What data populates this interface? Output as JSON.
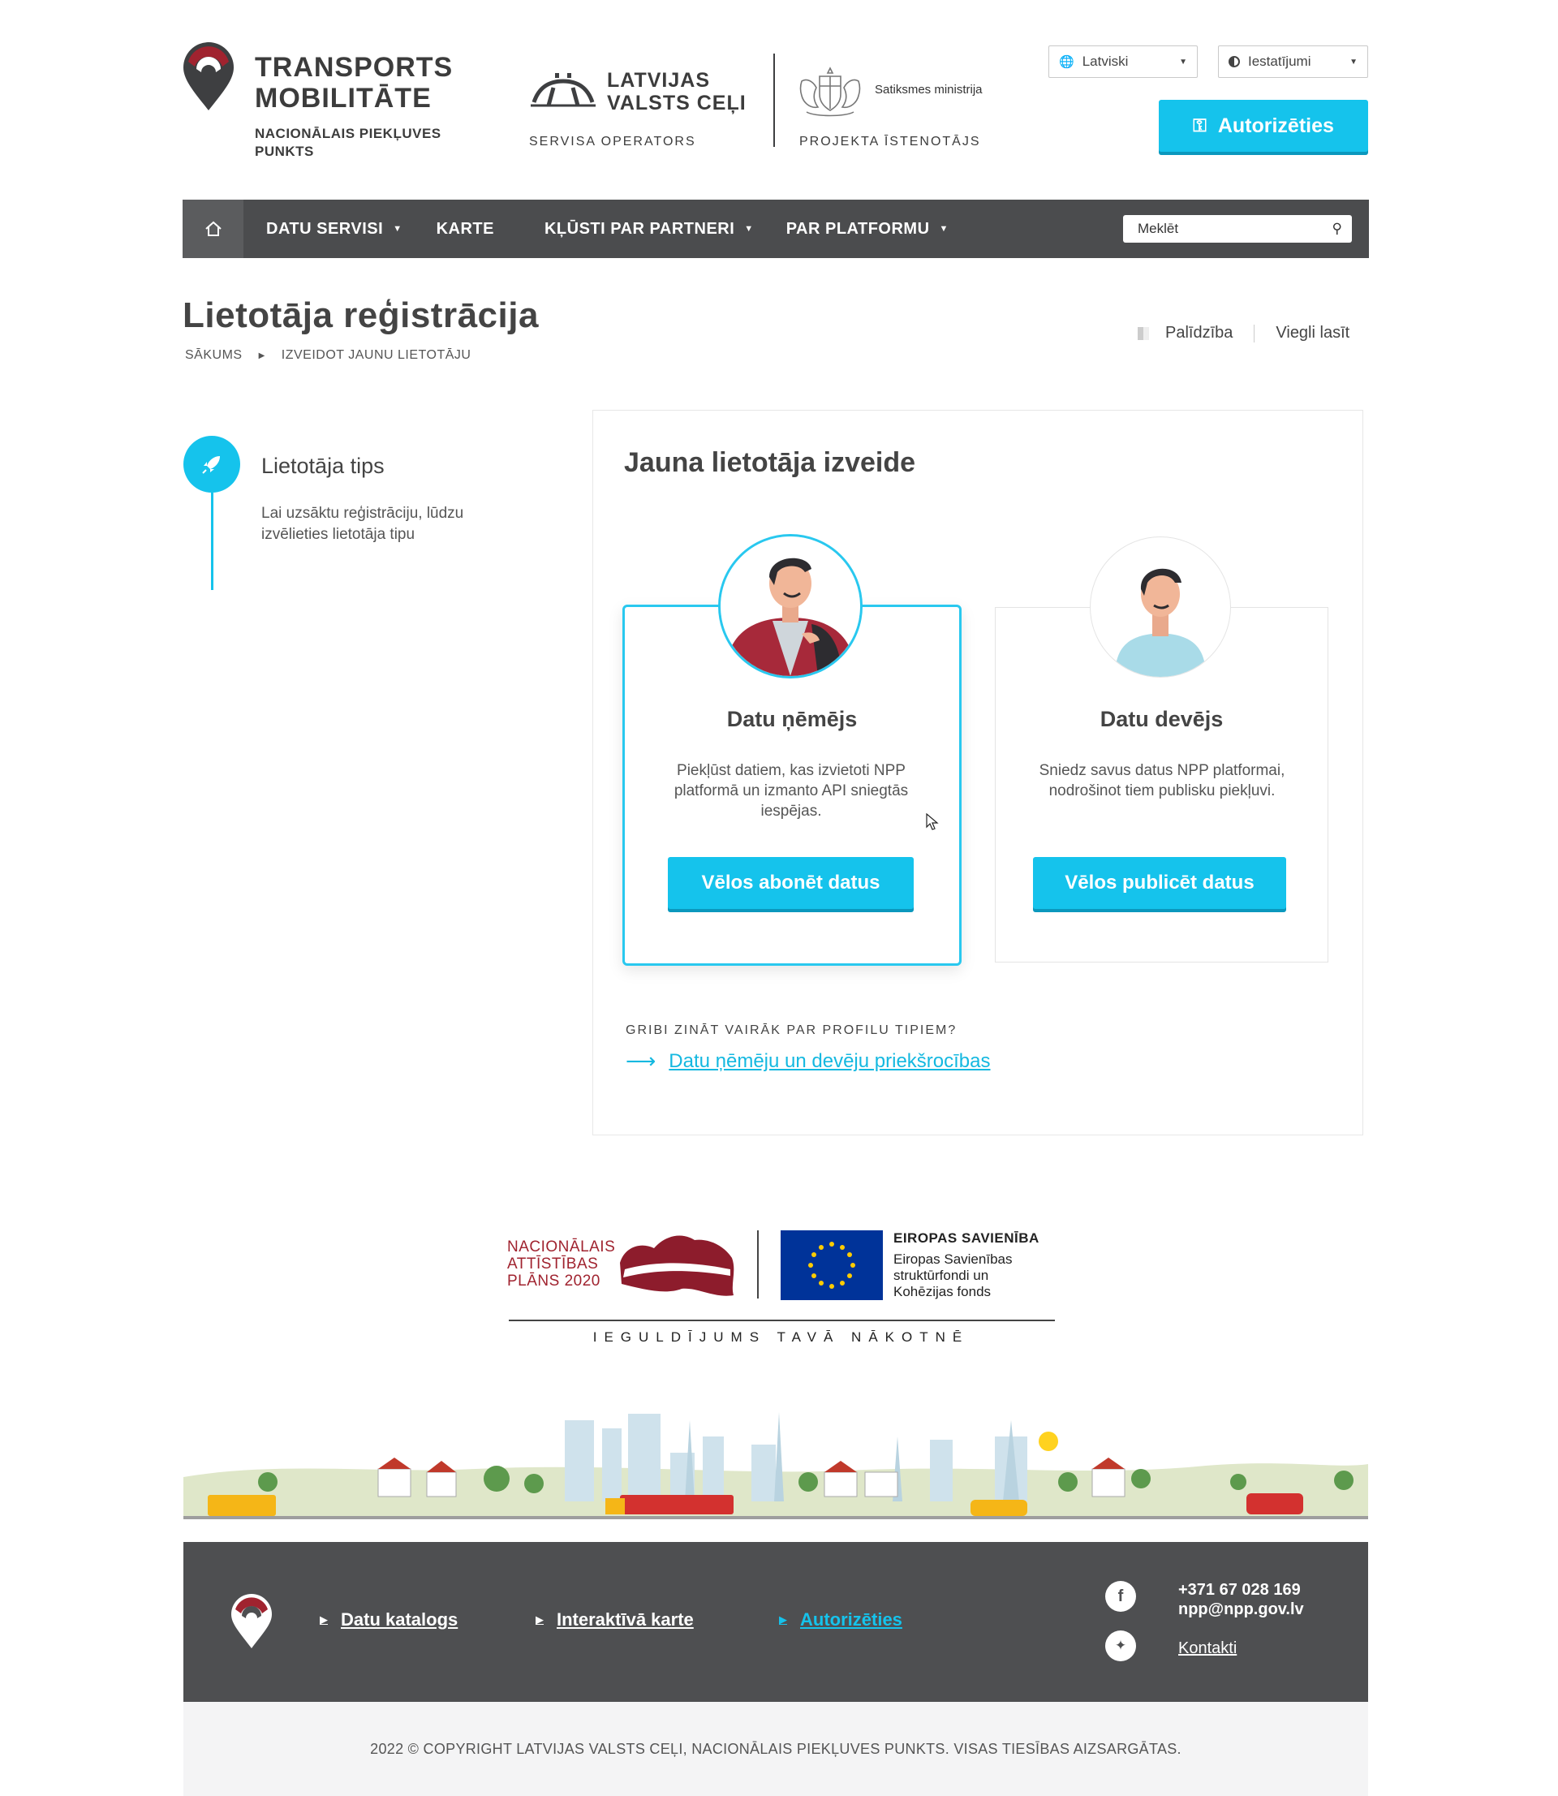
{
  "header": {
    "brand_title_1": "TRANSPORTS",
    "brand_title_2": "MOBILITĀTE",
    "brand_sub_1": "NACIONĀLAIS PIEKĻUVES",
    "brand_sub_2": "PUNKTS",
    "lvc_title_1": "LATVIJAS",
    "lvc_title_2": "VALSTS CEĻI",
    "lvc_role": "SERVISA OPERATORS",
    "ministry_name": "Satiksmes ministrija",
    "ministry_role": "PROJEKTA ĪSTENOTĀJS",
    "language": "Latviski",
    "settings": "Iestatījumi",
    "login_button": "Autorizēties"
  },
  "nav": {
    "items": [
      {
        "label": "DATU SERVISI",
        "dropdown": true
      },
      {
        "label": "KARTE",
        "dropdown": false
      },
      {
        "label": "KĻŪSTI PAR PARTNERI",
        "dropdown": true
      },
      {
        "label": "PAR PLATFORMU",
        "dropdown": true
      }
    ],
    "search_placeholder": "Meklēt"
  },
  "page": {
    "title": "Lietotāja reģistrācija",
    "breadcrumb": [
      "SĀKUMS",
      "IZVEIDOT JAUNU LIETOTĀJU"
    ],
    "help": "Palīdzība",
    "easy_read": "Viegli lasīt"
  },
  "steps": {
    "title": "Lietotāja tips",
    "description": "Lai uzsāktu reģistrāciju, lūdzu izvēlieties lietotāja tipu"
  },
  "panel": {
    "title": "Jauna lietotāja izveide",
    "cards": [
      {
        "title": "Datu ņēmējs",
        "text": "Piekļūst datiem, kas izvietoti NPP platformā un izmanto API sniegtās iespējas.",
        "button": "Vēlos abonēt datus"
      },
      {
        "title": "Datu devējs",
        "text": "Sniedz savus datus NPP platformai, nodrošinot tiem publisku piekļuvi.",
        "button": "Vēlos publicēt datus"
      }
    ],
    "more_label": "GRIBI ZINĀT VAIRĀK PAR PROFILU TIPIEM?",
    "more_link": "Datu ņēmēju un devēju priekšrocības"
  },
  "eu": {
    "nap_1": "NACIONĀLAIS",
    "nap_2": "ATTĪSTĪBAS",
    "nap_3": "PLĀNS 2020",
    "eu_title": "EIROPAS SAVIENĪBA",
    "eu_line_1": "Eiropas Savienības",
    "eu_line_2": "struktūrfondi un",
    "eu_line_3": "Kohēzijas fonds",
    "slogan": "IEGULDĪJUMS TAVĀ NĀKOTNĒ"
  },
  "footer": {
    "links": [
      "Datu katalogs",
      "Interaktīvā karte",
      "Autorizēties"
    ],
    "phone": "+371 67 028 169",
    "email": "npp@npp.gov.lv",
    "contacts": "Kontakti",
    "copyright": "2022 © COPYRIGHT LATVIJAS VALSTS CEĻI, NACIONĀLAIS PIEKĻUVES PUNKTS. VISAS TIESĪBAS AIZSARGĀTAS."
  },
  "colors": {
    "accent": "#15c3ec",
    "nav_bg": "#4b4c4e",
    "brand_red": "#a0232f",
    "footer_bg": "#4e4f51"
  }
}
